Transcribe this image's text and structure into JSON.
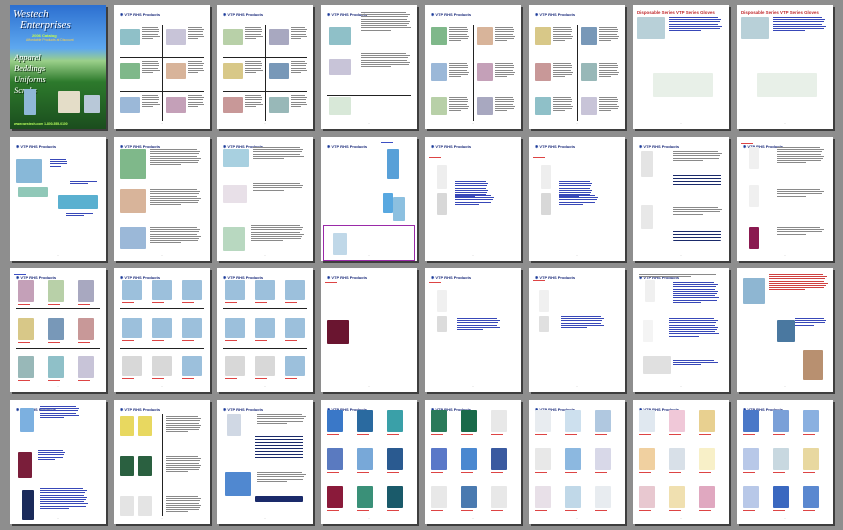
{
  "cover": {
    "title_line1": "Westech",
    "title_line2": "Enterprises",
    "catalog": "2006 Catalog",
    "tagline": "Affordable Products at Discount",
    "categories": [
      "Apparel",
      "Beddings",
      "Uniforms",
      "Scrubs"
    ],
    "footer": "www.westech.com  1-800-555-0100"
  },
  "header_label": "VTP RHS Products",
  "red_headers": [
    "Disposable Series VTP Series Gloves",
    "Disposable Series VTP Series Gloves"
  ],
  "colors": {
    "page_bg": "#ffffff",
    "canvas": "#8e8e8e",
    "header_blue": "#1a2a7a",
    "header_red": "#c0282c",
    "caption_red": "#d44444",
    "link_blue": "#3848b8"
  }
}
